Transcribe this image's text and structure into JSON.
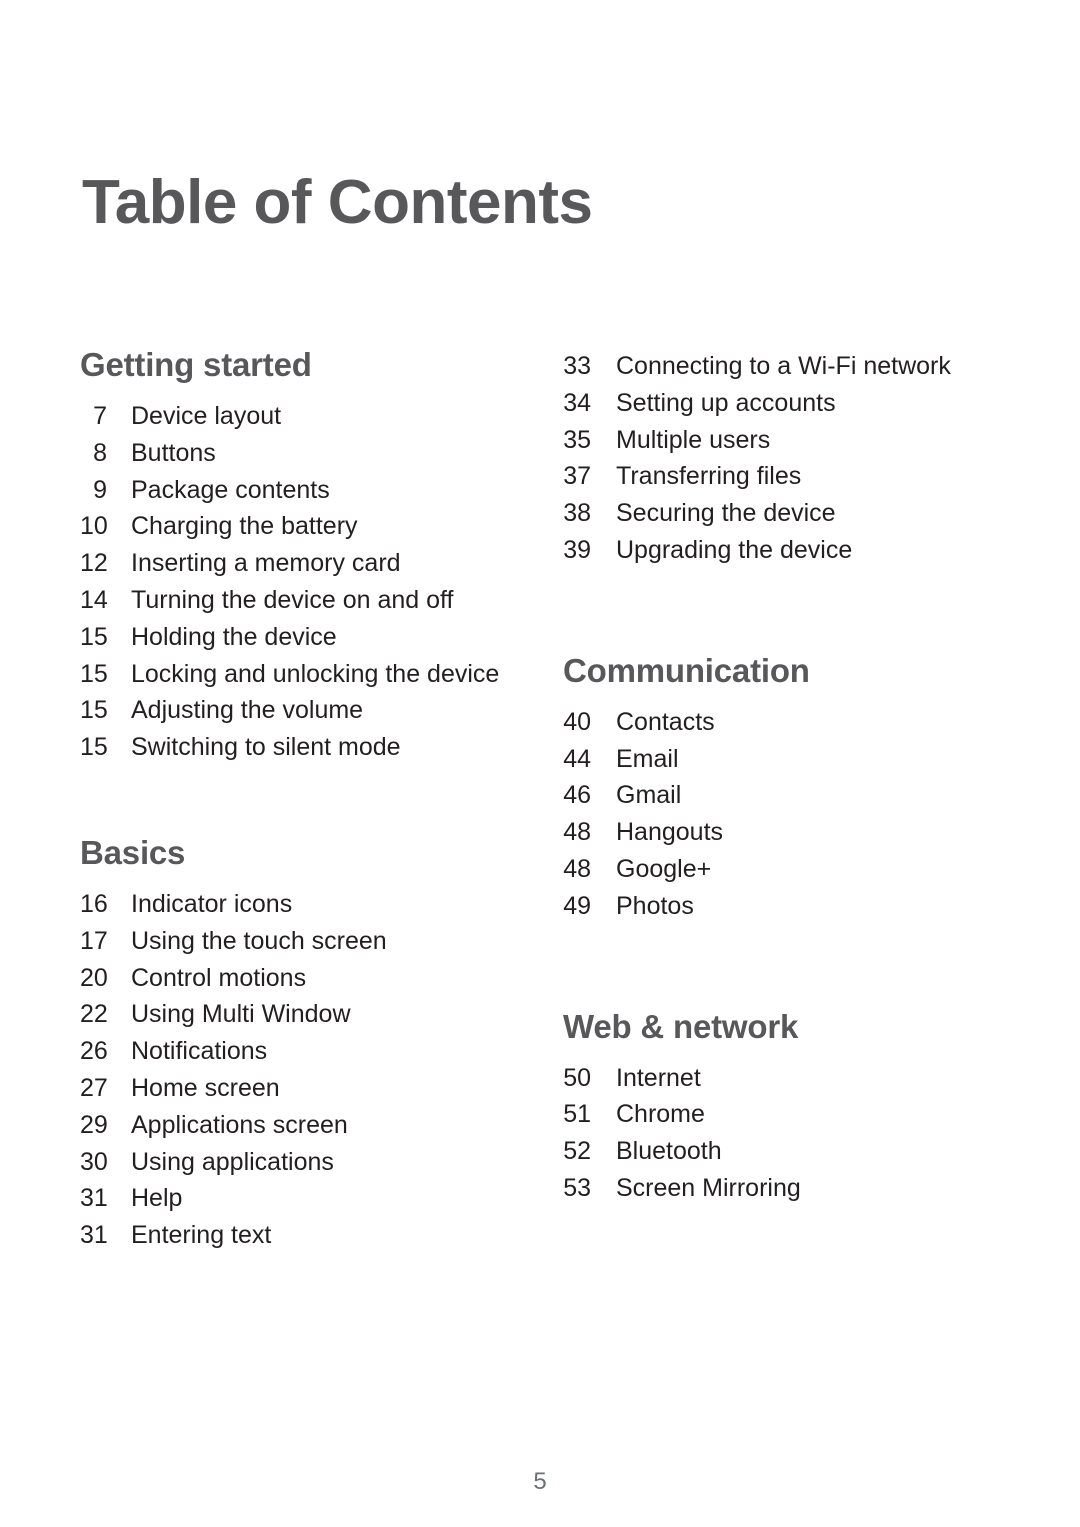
{
  "document": {
    "title": "Table of Contents",
    "page_number": "5",
    "colors": {
      "heading": "#58585b",
      "body_text": "#231f20",
      "page_number": "#6a7275",
      "background": "#ffffff"
    }
  },
  "left_column": {
    "sections": [
      {
        "heading": "Getting started",
        "entries": [
          {
            "page": "7",
            "label": "Device layout"
          },
          {
            "page": "8",
            "label": "Buttons"
          },
          {
            "page": "9",
            "label": "Package contents"
          },
          {
            "page": "10",
            "label": "Charging the battery"
          },
          {
            "page": "12",
            "label": "Inserting a memory card"
          },
          {
            "page": "14",
            "label": "Turning the device on and off"
          },
          {
            "page": "15",
            "label": "Holding the device"
          },
          {
            "page": "15",
            "label": "Locking and unlocking the device"
          },
          {
            "page": "15",
            "label": "Adjusting the volume"
          },
          {
            "page": "15",
            "label": "Switching to silent mode"
          }
        ]
      },
      {
        "heading": "Basics",
        "entries": [
          {
            "page": "16",
            "label": "Indicator icons"
          },
          {
            "page": "17",
            "label": "Using the touch screen"
          },
          {
            "page": "20",
            "label": "Control motions"
          },
          {
            "page": "22",
            "label": "Using Multi Window"
          },
          {
            "page": "26",
            "label": "Notifications"
          },
          {
            "page": "27",
            "label": "Home screen"
          },
          {
            "page": "29",
            "label": "Applications screen"
          },
          {
            "page": "30",
            "label": "Using applications"
          },
          {
            "page": "31",
            "label": "Help"
          },
          {
            "page": "31",
            "label": "Entering text"
          }
        ]
      }
    ]
  },
  "right_column": {
    "continued_entries": [
      {
        "page": "33",
        "label": "Connecting to a Wi-Fi network"
      },
      {
        "page": "34",
        "label": "Setting up accounts"
      },
      {
        "page": "35",
        "label": "Multiple users"
      },
      {
        "page": "37",
        "label": "Transferring files"
      },
      {
        "page": "38",
        "label": "Securing the device"
      },
      {
        "page": "39",
        "label": "Upgrading the device"
      }
    ],
    "sections": [
      {
        "heading": "Communication",
        "entries": [
          {
            "page": "40",
            "label": "Contacts"
          },
          {
            "page": "44",
            "label": "Email"
          },
          {
            "page": "46",
            "label": "Gmail"
          },
          {
            "page": "48",
            "label": "Hangouts"
          },
          {
            "page": "48",
            "label": "Google+"
          },
          {
            "page": "49",
            "label": "Photos"
          }
        ]
      },
      {
        "heading": "Web & network",
        "entries": [
          {
            "page": "50",
            "label": "Internet"
          },
          {
            "page": "51",
            "label": "Chrome"
          },
          {
            "page": "52",
            "label": "Bluetooth"
          },
          {
            "page": "53",
            "label": "Screen Mirroring"
          }
        ]
      }
    ]
  }
}
